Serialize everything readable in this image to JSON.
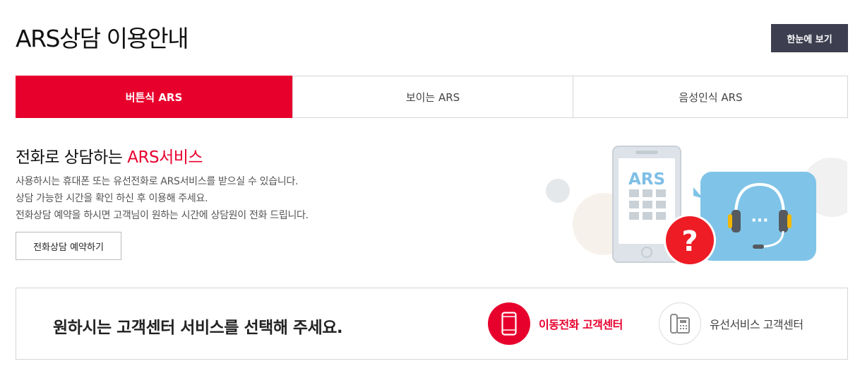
{
  "header": {
    "title": "ARS상담 이용안내",
    "overview_button": "한눈에 보기"
  },
  "tabs": [
    {
      "label": "버튼식 ARS",
      "active": true
    },
    {
      "label": "보이는 ARS",
      "active": false
    },
    {
      "label": "음성인식 ARS",
      "active": false
    }
  ],
  "intro": {
    "headline_prefix": "전화로 상담하는 ",
    "headline_accent": "ARS서비스",
    "lines": [
      "사용하시는 휴대폰 또는 유선전화로 ARS서비스를 받으실 수 있습니다.",
      "상담 가능한 시간을 확인 하신 후 이용해 주세요.",
      "전화상담 예약을 하시면 고객님이 원하는 시간에 상담원이 전화 드립니다."
    ],
    "reserve_button": "전화상담 예약하기"
  },
  "illustration": {
    "phone_screen_text": "ARS",
    "question_mark": "?",
    "bubble_dots": "···"
  },
  "service_select": {
    "title": "원하시는 고객센터 서비스를 선택해 주세요.",
    "options": [
      {
        "label": "이동전화 고객센터",
        "icon": "mobile-phone-icon",
        "selected": true
      },
      {
        "label": "유선서비스 고객센터",
        "icon": "desk-phone-icon",
        "selected": false
      }
    ]
  },
  "colors": {
    "accent": "#e8002d",
    "dark_button": "#3d3e4f",
    "illustration_blue": "#7fc4e8"
  }
}
